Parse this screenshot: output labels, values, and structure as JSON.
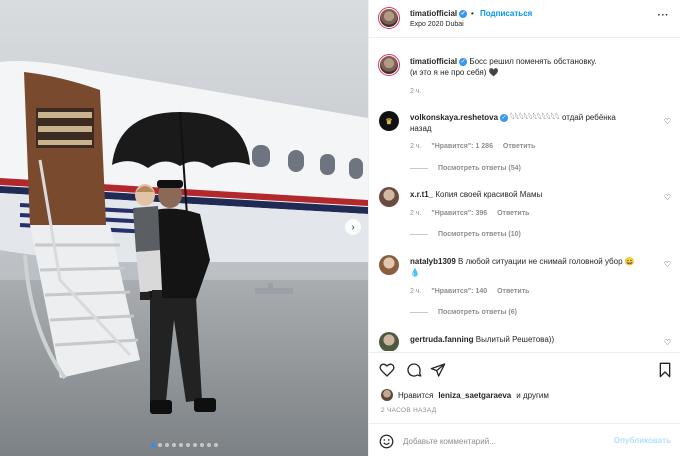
{
  "post": {
    "author": "timatiofficial",
    "follow_label": "Подписаться",
    "separator": "•",
    "location": "Expo 2020 Dubai",
    "more_glyph": "···",
    "caption_line1": "Босс решил поменять обстановку.",
    "caption_line2": "(и это я не про себя) 🖤",
    "caption_time": "2 ч."
  },
  "comments": [
    {
      "user": "volkonskaya.reshetova",
      "verified": true,
      "text": "𓆩𓆩𓆩𓆩𓆩𓆩𓆩𓆩𓆩𓆩𓆩 отдай ребёнка",
      "text2": "назад",
      "time": "2 ч.",
      "likes": "\"Нравится\": 1 286",
      "reply": "Ответить",
      "replies": "Посмотреть ответы (54)"
    },
    {
      "user": "x.r.t1_",
      "verified": false,
      "text": "Копия своей красивой Мамы",
      "text2": "",
      "time": "2 ч.",
      "likes": "\"Нравится\": 396",
      "reply": "Ответить",
      "replies": "Посмотреть ответы (10)"
    },
    {
      "user": "natalyb1309",
      "verified": false,
      "text": "В любой ситуации не снимай головной убор 😄",
      "text2": "💧",
      "time": "2 ч.",
      "likes": "\"Нравится\": 140",
      "reply": "Ответить",
      "replies": "Посмотреть ответы (6)"
    },
    {
      "user": "gertruda.fanning",
      "verified": false,
      "text": "Вылитый Решетова))",
      "text2": "",
      "time": "",
      "likes": "",
      "reply": "",
      "replies": ""
    }
  ],
  "likes_bar": {
    "prefix": "Нравится",
    "user": "leniza_saetgaraeva",
    "suffix": "и другим",
    "time": "2 ЧАСОВ НАЗАД"
  },
  "composer": {
    "placeholder": "Добавьте комментарий...",
    "publish": "Опубликовать"
  },
  "carousel": {
    "count": 10,
    "active_index": 0
  },
  "colors": {
    "accent": "#0095f6",
    "verified": "#3897f0",
    "muted": "#8e8e8e"
  },
  "icons": [
    "verified-badge-icon",
    "more-options-icon",
    "heart-icon",
    "comment-icon",
    "share-icon",
    "bookmark-icon",
    "emoji-icon",
    "next-arrow-icon"
  ]
}
